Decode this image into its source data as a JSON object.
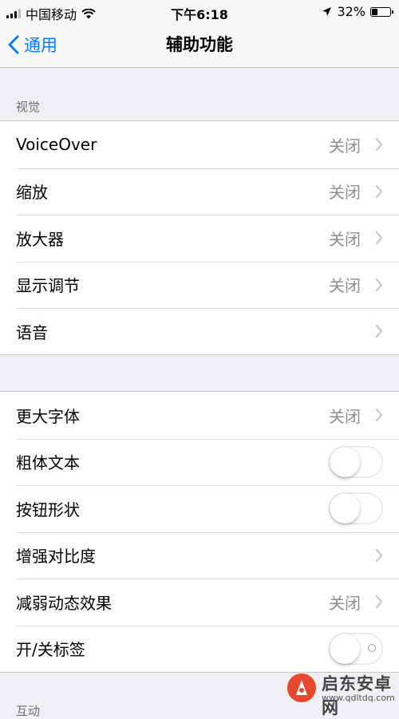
{
  "status_bar": {
    "carrier": "中国移动",
    "time": "下午6:18",
    "battery": "32%",
    "battery_level": 0.32
  },
  "nav": {
    "back_label": "通用",
    "title": "辅助功能"
  },
  "vision": {
    "header": "视觉",
    "rows": [
      {
        "label": "VoiceOver",
        "value": "关闭"
      },
      {
        "label": "缩放",
        "value": "关闭"
      },
      {
        "label": "放大器",
        "value": "关闭"
      },
      {
        "label": "显示调节",
        "value": "关闭"
      },
      {
        "label": "语音",
        "value": ""
      }
    ]
  },
  "display": {
    "rows": [
      {
        "label": "更大字体",
        "value": "关闭"
      },
      {
        "label": "粗体文本",
        "toggle": false
      },
      {
        "label": "按钮形状",
        "toggle": false
      },
      {
        "label": "增强对比度",
        "value": ""
      },
      {
        "label": "减弱动态效果",
        "value": "关闭"
      },
      {
        "label": "开/关标签",
        "toggle": false
      }
    ]
  },
  "next_section": {
    "header": "互动"
  },
  "watermark": {
    "name": "启东安卓网",
    "url": "www.qdltdq.com"
  },
  "colors": {
    "accent": "#0a7aff",
    "background": "#efeff4",
    "secondary_text": "#8e8e93"
  }
}
